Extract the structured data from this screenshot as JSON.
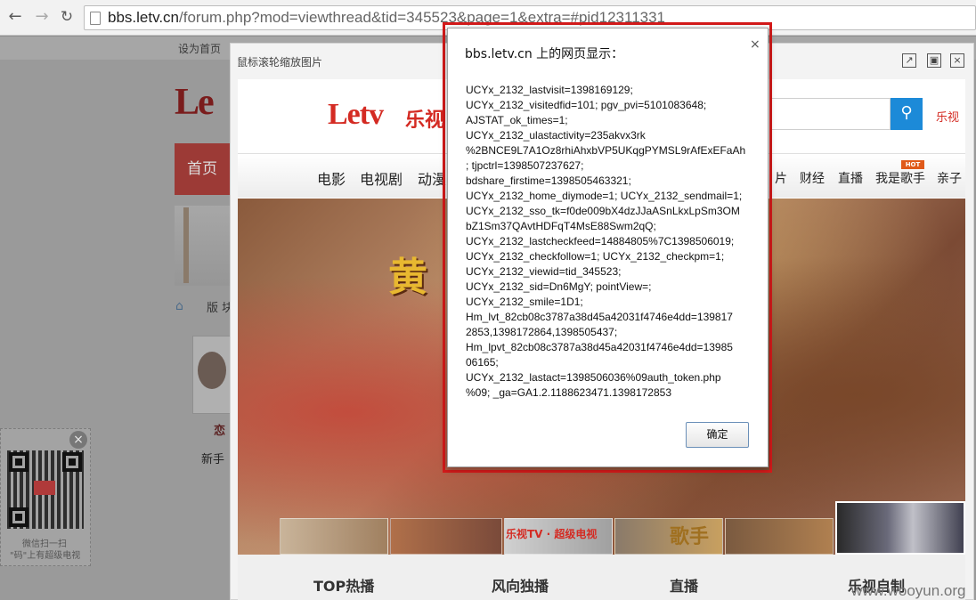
{
  "browser": {
    "back_icon": "arrow-left-icon",
    "forward_icon": "arrow-right-icon",
    "reload_icon": "reload-icon",
    "url_host": "bbs.letv.cn",
    "url_path": "/forum.php?mod=viewthread&tid=345523&page=1&extra=#pid12311331"
  },
  "background_page": {
    "set_home": "设为首页",
    "logo": "Le",
    "home_tab": "首页",
    "breadcrumb": "版 块",
    "username": "恋",
    "user_rank": "新手"
  },
  "qr_widget": {
    "close": "×",
    "caption_line1": "微信扫一扫",
    "caption_line2": "\"码\"上有超级电视"
  },
  "image_viewer": {
    "hint": "鼠标滚轮缩放图片",
    "open_icon": "↗",
    "maximize_icon": "▣",
    "close_icon": "×",
    "inner_page": {
      "logo": "Letv",
      "logo_cn": "乐视",
      "search_icon": "magnifier-icon",
      "lesee": "乐视",
      "nav": [
        "电影",
        "电视剧",
        "动漫",
        "片",
        "财经",
        "直播",
        "我是歌手",
        "亲子"
      ],
      "hot_badge": "HOT",
      "banner_title": "黄",
      "thumb_labels": [
        "乐视TV · 超级电视",
        "歌手"
      ],
      "footer_tabs": [
        "TOP热播",
        "风向独播",
        "直播",
        "乐视自制"
      ]
    }
  },
  "alert_dialog": {
    "title": "bbs.letv.cn 上的网页显示：",
    "close": "×",
    "message_lines": [
      "UCYx_2132_lastvisit=1398169129;",
      "UCYx_2132_visitedfid=101; pgv_pvi=5101083648;",
      "AJSTAT_ok_times=1;",
      "UCYx_2132_ulastactivity=235akvx3rk",
      "%2BNCE9L7A1Oz8rhiAhxbVP5UKqgPYMSL9rAfExEFaAh",
      "; tjpctrl=1398507237627;",
      "bdshare_firstime=1398505463321;",
      "UCYx_2132_home_diymode=1; UCYx_2132_sendmail=1;",
      "UCYx_2132_sso_tk=f0de009bX4dzJJaASnLkxLpSm3OM",
      "bZ1Sm37QAvtHDFqT4MsE88Swm2qQ;",
      "UCYx_2132_lastcheckfeed=14884805%7C1398506019;",
      "UCYx_2132_checkfollow=1; UCYx_2132_checkpm=1;",
      "UCYx_2132_viewid=tid_345523;",
      "UCYx_2132_sid=Dn6MgY; pointView=;",
      "UCYx_2132_smile=1D1;",
      "Hm_lvt_82cb08c3787a38d45a42031f4746e4dd=139817",
      "2853,1398172864,1398505437;",
      "Hm_lpvt_82cb08c3787a38d45a42031f4746e4dd=13985",
      "06165;",
      "UCYx_2132_lastact=1398506036%09auth_token.php",
      "%09; _ga=GA1.2.1188623471.1398172853"
    ],
    "ok_button": "确定"
  },
  "watermark": "www.wooyun.org"
}
